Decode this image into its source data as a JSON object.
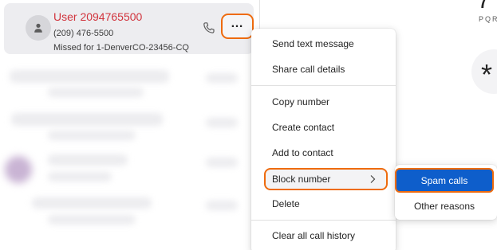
{
  "call_entry": {
    "caller_name": "User 2094765500",
    "phone_number": "(209) 476-5500",
    "missed_text": "Missed for 1-DenverCO-23456-CQ",
    "more_label": "…"
  },
  "dialpad": {
    "key_7_digit": "7",
    "key_7_letters": "PQRS",
    "star_key": "*"
  },
  "context_menu": {
    "items": [
      "Send text message",
      "Share call details",
      "Copy number",
      "Create contact",
      "Add to contact",
      "Block number",
      "Delete",
      "Clear all call history"
    ]
  },
  "block_submenu": {
    "items": [
      "Spam calls",
      "Other reasons"
    ]
  },
  "colors": {
    "accent_orange": "#ee6b0e",
    "selected_blue": "#0e5ecb",
    "missed_red": "#d1343d"
  }
}
